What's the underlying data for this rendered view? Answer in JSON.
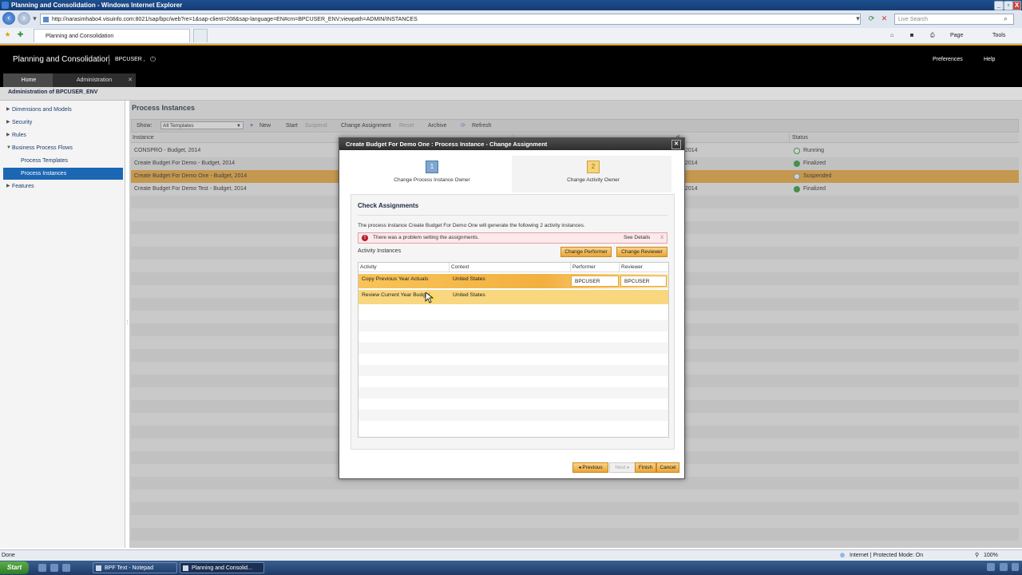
{
  "window": {
    "title": "Planning and Consolidation - Windows Internet Explorer",
    "min": "_",
    "max": "▫",
    "close": "X"
  },
  "browser": {
    "address": "http://narasimhabo4.visuinfo.com:8021/sap/bpc/web?re=1&sap-client=208&sap-language=EN#cm=BPCUSER_ENV;viewpath=ADMIN/INSTANCES",
    "search_placeholder": "Live Search",
    "tab_title": "Planning and Consolidation",
    "page_menu": "Page",
    "tools_menu": "Tools"
  },
  "app": {
    "title": "Planning and Consolidation",
    "user": "BPCUSER ,",
    "preferences": "Preferences",
    "help": "Help",
    "tabs": [
      {
        "label": "Home"
      },
      {
        "label": "Administration"
      }
    ],
    "env_title": "Administration of BPCUSER_ENV"
  },
  "nav": {
    "items": [
      {
        "label": "Dimensions and Models"
      },
      {
        "label": "Security"
      },
      {
        "label": "Rules"
      },
      {
        "label": "Business Process Flows"
      },
      {
        "label": "Process Templates"
      },
      {
        "label": "Process Instances"
      },
      {
        "label": "Features"
      }
    ]
  },
  "main": {
    "title": "Process Instances",
    "toolbar": {
      "show_label": "Show:",
      "show_value": "All Templates",
      "new": "New",
      "start": "Start",
      "suspend": "Suspend",
      "change_assignment": "Change Assignment",
      "reset": "Reset",
      "archive": "Archive",
      "refresh": "Refresh"
    },
    "columns": {
      "instance": "Instance",
      "mid": "d",
      "status": "Status"
    },
    "rows": [
      {
        "instance": "CONSPRO - Budget, 2014",
        "date": "2014",
        "status": "Running"
      },
      {
        "instance": "Create Budget For Demo - Budget, 2014",
        "date": "2014",
        "status": "Finalized"
      },
      {
        "instance": "Create Budget For Demo One - Budget, 2014",
        "date": "",
        "status": "Suspended"
      },
      {
        "instance": "Create Budget For Demo Test - Budget, 2014",
        "date": "2014",
        "status": "Finalized"
      }
    ]
  },
  "dialog": {
    "title": "Create Budget For Demo One : Process Instance - Change Assignment",
    "steps": [
      {
        "num": "1",
        "label": "Change Process Instance Owner"
      },
      {
        "num": "2",
        "label": "Change Activity Owner"
      }
    ],
    "section_title": "Check Assignments",
    "message": "The process instance Create Budget For Demo One will generate the following 2 activity instances.",
    "error": {
      "text": "There was a problem setting the assignments.",
      "details": "See Details",
      "close": "X"
    },
    "activity_instances_label": "Activity Instances",
    "change_performer": "Change Performer",
    "change_reviewer": "Change Reviewer",
    "columns": {
      "activity": "Activity",
      "context": "Context",
      "performer": "Performer",
      "reviewer": "Reviewer"
    },
    "rows": [
      {
        "activity": "Copy Previous Year Actuals",
        "context": "United States",
        "performer": "BPCUSER",
        "reviewer": "BPCUSER"
      },
      {
        "activity": "Review Current Year Budget",
        "context": "United States",
        "performer": "",
        "reviewer": ""
      }
    ],
    "buttons": {
      "previous": "Previous",
      "next": "Next",
      "finish": "Finish",
      "cancel": "Cancel"
    }
  },
  "status_bar": {
    "left": "Done",
    "zone": "Internet | Protected Mode: On",
    "zoom": "100%"
  },
  "taskbar": {
    "start": "Start",
    "tasks": [
      {
        "label": "BPF Text - Notepad"
      },
      {
        "label": "Planning and Consolid..."
      }
    ]
  },
  "colors": {
    "accent": "#efaa3a",
    "selection_blue": "#1b67b4",
    "error": "#b81d2c"
  }
}
